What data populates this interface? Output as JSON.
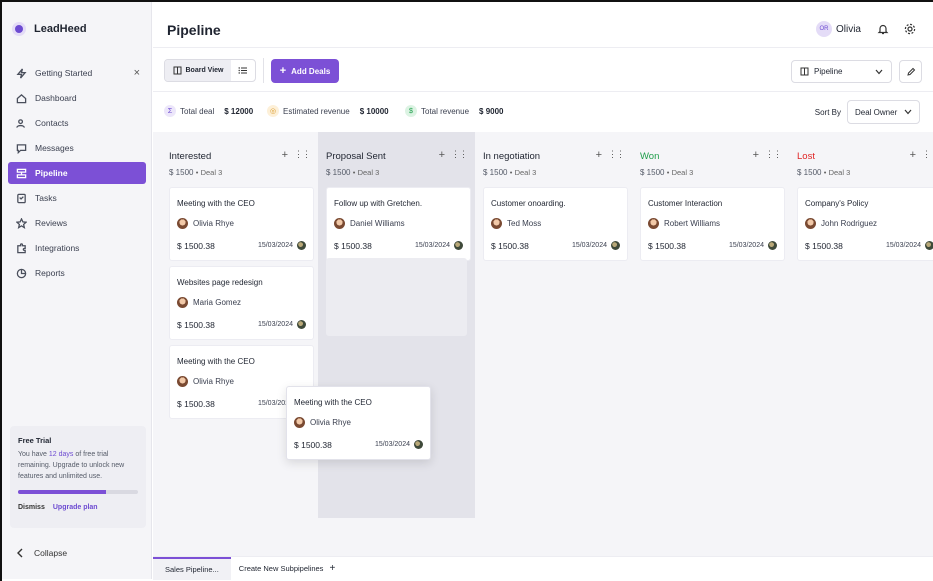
{
  "app": {
    "brand": "LeadHeed"
  },
  "sidebar": {
    "items": [
      {
        "label": "Getting Started",
        "icon": "lightning-icon"
      },
      {
        "label": "Dashboard",
        "icon": "home-icon"
      },
      {
        "label": "Contacts",
        "icon": "users-icon"
      },
      {
        "label": "Messages",
        "icon": "chat-icon"
      },
      {
        "label": "Pipeline",
        "icon": "pipeline-icon"
      },
      {
        "label": "Tasks",
        "icon": "tasks-icon"
      },
      {
        "label": "Reviews",
        "icon": "star-icon"
      },
      {
        "label": "Integrations",
        "icon": "puzzle-icon"
      },
      {
        "label": "Reports",
        "icon": "chart-icon"
      }
    ],
    "close_glyph": "×",
    "trial": {
      "title": "Free Trial",
      "text_before": "You have ",
      "days": "12 days",
      "text_after": " of free trial remaining. Upgrade to unlock new features and unlimited use.",
      "progress": 0.73,
      "dismiss": "Dismiss",
      "upgrade": "Upgrade plan"
    },
    "collapse": "Collapse"
  },
  "header": {
    "title": "Pipeline",
    "user_initials": "OR",
    "user_name": "Olivia"
  },
  "toolbar": {
    "board_view": "Board View",
    "add_deals": "Add Deals",
    "pipeline_select": "Pipeline"
  },
  "stats": {
    "total_deal_label": "Total deal",
    "total_deal_value": "$ 12000",
    "est_rev_label": "Estimated revenue",
    "est_rev_value": "$ 10000",
    "total_rev_label": "Total revenue",
    "total_rev_value": "$ 9000",
    "sort_label": "Sort By",
    "sort_value": "Deal Owner"
  },
  "columns": [
    {
      "name": "Interested",
      "color": "#1f2430",
      "amount": "$ 1500",
      "deals": "Deal 3",
      "cards": [
        {
          "title": "Meeting with the CEO",
          "person": "Olivia Rhye",
          "amount": "$ 1500.38",
          "date": "15/03/2024"
        },
        {
          "title": "Websites page redesign",
          "person": "Maria Gomez",
          "amount": "$ 1500.38",
          "date": "15/03/2024"
        },
        {
          "title": "Meeting with the CEO",
          "person": "Olivia Rhye",
          "amount": "$ 1500.38",
          "date": "15/03/2024"
        }
      ]
    },
    {
      "name": "Proposal Sent",
      "color": "#1f2430",
      "amount": "$ 1500",
      "deals": "Deal 3",
      "cards": [
        {
          "title": "Follow up with Gretchen.",
          "person": "Daniel Williams",
          "amount": "$ 1500.38",
          "date": "15/03/2024"
        }
      ]
    },
    {
      "name": "In negotiation",
      "color": "#1f2430",
      "amount": "$ 1500",
      "deals": "Deal 3",
      "cards": [
        {
          "title": "Customer onoarding.",
          "person": "Ted Moss",
          "amount": "$ 1500.38",
          "date": "15/03/2024"
        }
      ]
    },
    {
      "name": "Won",
      "color": "#1e9e4a",
      "amount": "$ 1500",
      "deals": "Deal 3",
      "cards": [
        {
          "title": "Customer Interaction",
          "person": "Robert Williams",
          "amount": "$ 1500.38",
          "date": "15/03/2024"
        }
      ]
    },
    {
      "name": "Lost",
      "color": "#e02424",
      "amount": "$ 1500",
      "deals": "Deal 3",
      "cards": [
        {
          "title": "Company's Policy",
          "person": "John Rodriguez",
          "amount": "$ 1500.38",
          "date": "15/03/2024"
        }
      ]
    }
  ],
  "dragging_card": {
    "title": "Meeting with the CEO",
    "person": "Olivia Rhye",
    "amount": "$ 1500.38",
    "date": "15/03/2024"
  },
  "bottom_tabs": {
    "active": "Sales Pipeline...",
    "create": "Create New Subpipelines",
    "plus": "+"
  },
  "colors": {
    "accent": "#7c50d6",
    "won": "#1e9e4a",
    "lost": "#e02424"
  }
}
